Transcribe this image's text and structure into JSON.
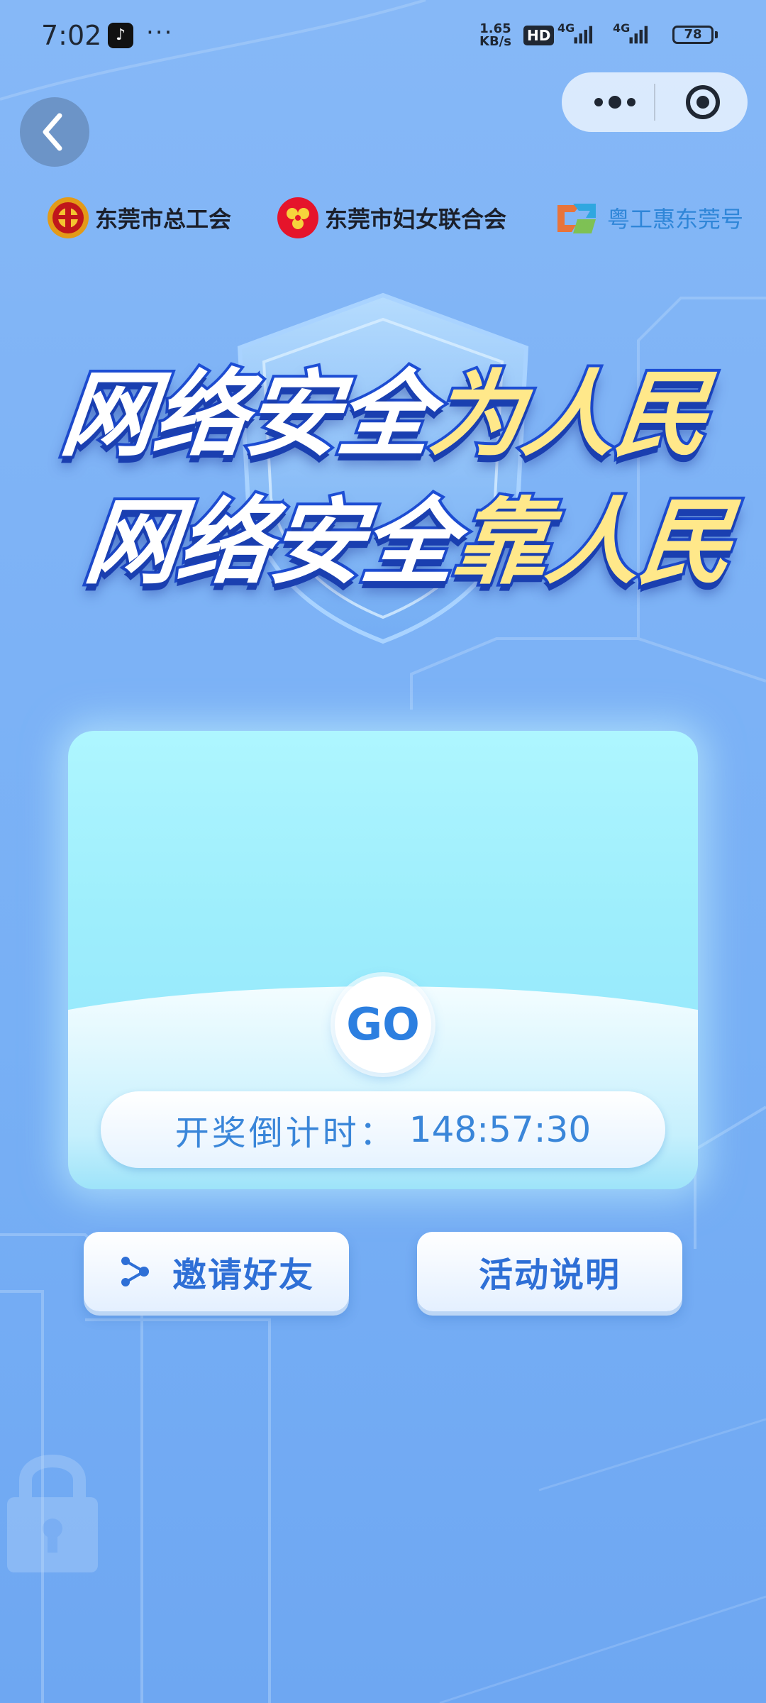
{
  "status_bar": {
    "time": "7:02",
    "app_icon": "tiktok-icon",
    "more": "···",
    "net_speed_value": "1.65",
    "net_speed_unit": "KB/s",
    "hd": "HD",
    "network_1": "4G",
    "network_2": "4G",
    "battery": "78"
  },
  "nav": {
    "back_icon": "chevron-left-icon",
    "more_icon": "more-dots-icon",
    "close_icon": "target-icon"
  },
  "organizers": [
    {
      "name": "东莞市总工会",
      "icon": "trade-union-logo"
    },
    {
      "name": "东莞市妇女联合会",
      "icon": "womens-federation-logo"
    },
    {
      "name": "粤工惠东莞号",
      "icon": "yuegonghui-logo"
    }
  ],
  "banner": {
    "line1_white": "网络安全",
    "line1_yellow": "为人民",
    "line2_white": "网络安全",
    "line2_yellow": "靠人民"
  },
  "lottery": {
    "go_label": "GO",
    "countdown_label": "开奖倒计时：",
    "countdown_value": "148:57:30"
  },
  "actions": {
    "invite_label": "邀请好友",
    "rules_label": "活动说明"
  },
  "colors": {
    "background": "#7eb3f6",
    "accent": "#2e6fd6",
    "banner_yellow": "#ffe88a",
    "card_cyan": "#9eeefc"
  }
}
